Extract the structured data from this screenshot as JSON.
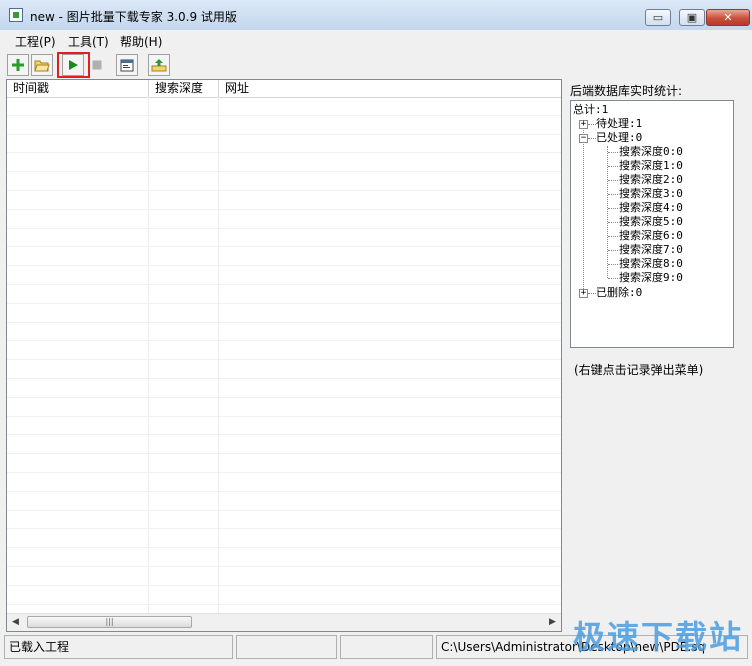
{
  "window": {
    "title": "new - 图片批量下载专家 3.0.9 试用版",
    "minimize_label": "▭",
    "maximize_label": "▣",
    "close_label": "✕"
  },
  "menu": [
    "工程(P)",
    "工具(T)",
    "帮助(H)"
  ],
  "toolbar": {
    "icons": [
      "add-icon",
      "open-folder-icon",
      "play-icon",
      "stop-icon",
      "properties-icon",
      "export-icon"
    ]
  },
  "table": {
    "columns": [
      "时间戳",
      "搜索深度",
      "网址"
    ],
    "rows": []
  },
  "stats": {
    "label": "后端数据库实时统计:",
    "tree": {
      "total": "总计:1",
      "pending": "待处理:1",
      "processed": "已处理:0",
      "depths": [
        "搜索深度0:0",
        "搜索深度1:0",
        "搜索深度2:0",
        "搜索深度3:0",
        "搜索深度4:0",
        "搜索深度5:0",
        "搜索深度6:0",
        "搜索深度7:0",
        "搜索深度8:0",
        "搜索深度9:0"
      ],
      "deleted": "已删除:0"
    },
    "hint": "(右键点击记录弹出菜单)"
  },
  "statusbar": {
    "message": "已载入工程",
    "pane2": "",
    "pane3": "",
    "path": "C:\\Users\\Administrator\\Desktop\\new\\PDE.sq"
  },
  "watermark": "极速下载站",
  "colors": {
    "highlight": "#e02020",
    "play_green": "#1a8a1a",
    "add_green": "#2a9a2a"
  }
}
